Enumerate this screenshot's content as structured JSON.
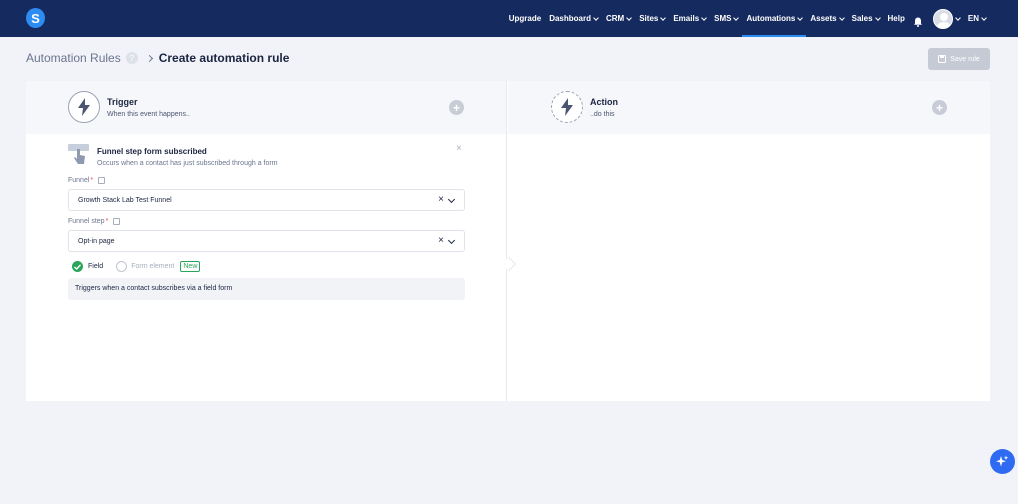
{
  "header": {
    "logo_letter": "S",
    "nav": [
      {
        "label": "Upgrade",
        "dropdown": false,
        "active": false
      },
      {
        "label": "Dashboard",
        "dropdown": true,
        "active": false
      },
      {
        "label": "CRM",
        "dropdown": true,
        "active": false
      },
      {
        "label": "Sites",
        "dropdown": true,
        "active": false
      },
      {
        "label": "Emails",
        "dropdown": true,
        "active": false
      },
      {
        "label": "SMS",
        "dropdown": true,
        "active": false
      },
      {
        "label": "Automations",
        "dropdown": true,
        "active": true
      },
      {
        "label": "Assets",
        "dropdown": true,
        "active": false
      },
      {
        "label": "Sales",
        "dropdown": true,
        "active": false
      },
      {
        "label": "Help",
        "dropdown": false,
        "active": false
      }
    ],
    "language": "EN",
    "colors": {
      "bar": "#152a5e",
      "accent": "#2d8cf2"
    }
  },
  "breadcrumb": {
    "parent": "Automation Rules",
    "help_icon": "?",
    "current": "Create automation rule"
  },
  "toolbar": {
    "save_label": "Save rule"
  },
  "trigger": {
    "title": "Trigger",
    "subtitle": "When this event happens..",
    "event_title": "Funnel step form subscribed",
    "event_desc": "Occurs when a contact has just subscribed through a form",
    "close": "×",
    "funnel_label": "Funnel",
    "funnel_value": "Growth Stack Lab Test Funnel",
    "step_label": "Funnel step",
    "step_value": "Opt-in page",
    "required_mark": "*",
    "clear": "×",
    "option_field": "Field",
    "option_form_element": "Form element",
    "new_badge": "New",
    "info": "Triggers when a contact subscribes via a field form"
  },
  "action": {
    "title": "Action",
    "subtitle": "..do this"
  }
}
